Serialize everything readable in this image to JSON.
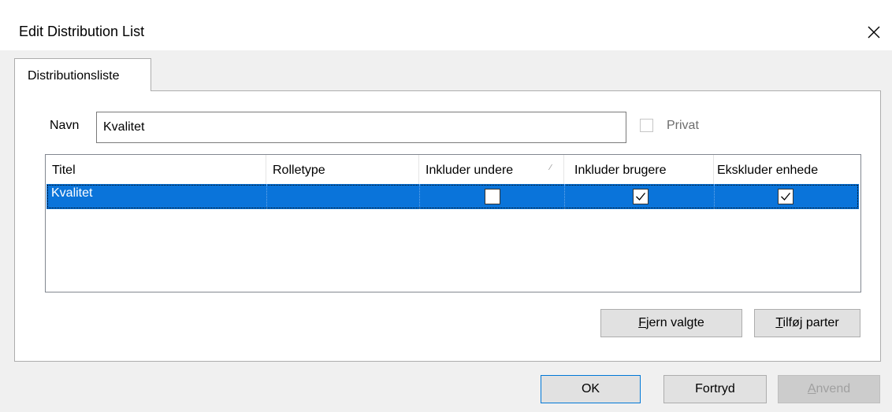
{
  "dialog": {
    "title": "Edit Distribution List",
    "close_icon": "close-icon"
  },
  "tabs": [
    {
      "label": "Distributionsliste",
      "active": true
    }
  ],
  "form": {
    "name_label": "Navn",
    "name_value": "Kvalitet",
    "private_label": "Privat",
    "private_checked": false,
    "private_enabled": false
  },
  "grid": {
    "columns": [
      {
        "label": "Titel"
      },
      {
        "label": "Rolletype"
      },
      {
        "label": "Inkluder undere"
      },
      {
        "label": "Inkluder brugere"
      },
      {
        "label": "Ekskluder enhede"
      }
    ],
    "rows": [
      {
        "titel": "Kvalitet",
        "rolletype": "",
        "inkluder_undere": false,
        "inkluder_brugere": true,
        "ekskluder_enhede": true,
        "selected": true
      }
    ]
  },
  "buttons": {
    "remove_selected": {
      "before": "",
      "accel": "F",
      "after": "jern valgte"
    },
    "add_parties": {
      "before": "",
      "accel": "T",
      "after": "ilføj parter"
    },
    "ok": "OK",
    "cancel": "Fortryd",
    "apply": {
      "before": "",
      "accel": "A",
      "after": "nvend",
      "enabled": false
    }
  },
  "colors": {
    "selection": "#0a74da",
    "window_bg": "#f0f0f0"
  }
}
